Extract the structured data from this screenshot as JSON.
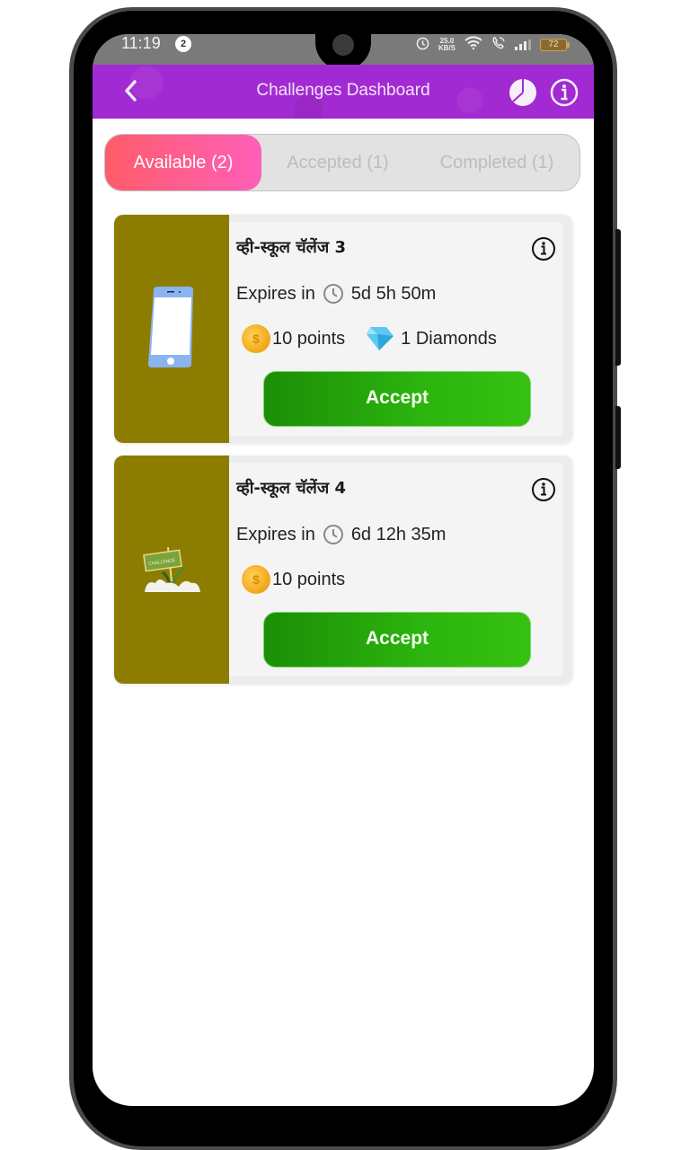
{
  "status_bar": {
    "time": "11:19",
    "notification_count": "2",
    "network_speed_value": "25.0",
    "network_speed_unit": "KB/S",
    "battery_level": "72"
  },
  "app_bar": {
    "title": "Challenges Dashboard",
    "back_icon": "chevron-left-icon",
    "stats_icon": "pie-chart-icon",
    "info_icon": "info-icon",
    "background_color": "#a22ad2"
  },
  "tabs": [
    {
      "label": "Available (2)",
      "active": true
    },
    {
      "label": "Accepted (1)",
      "active": false
    },
    {
      "label": "Completed (1)",
      "active": false
    }
  ],
  "challenges": [
    {
      "title": "व्ही-स्कूल चॅलेंज 3",
      "expires_label": "Expires in",
      "expires_value": "5d 5h 50m",
      "points": "10 points",
      "diamonds": "1 Diamonds",
      "thumbnail": "smartphone-illustration",
      "accept_label": "Accept"
    },
    {
      "title": "व्ही-स्कूल चॅलेंज 4",
      "expires_label": "Expires in",
      "expires_value": "6d 12h 35m",
      "points": "10 points",
      "thumbnail": "challenge-signboard-illustration",
      "thumbnail_sign_text": "CHALLENGE",
      "accept_label": "Accept"
    }
  ],
  "colors": {
    "tab_active_gradient_start": "#ff5c6a",
    "tab_active_gradient_end": "#ff5fb8",
    "card_thumb": "#8c7d00",
    "accept_green": "#2cb50e"
  }
}
